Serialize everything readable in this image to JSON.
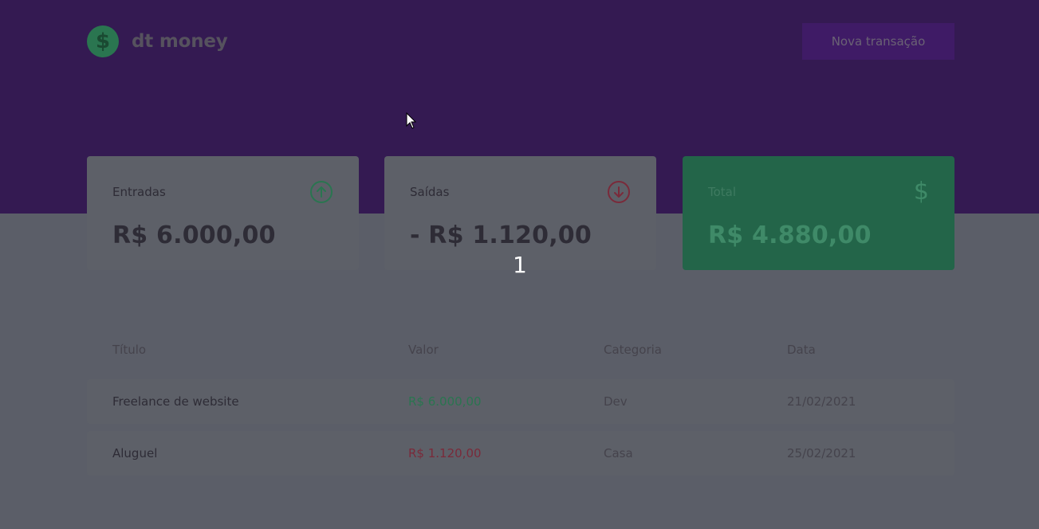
{
  "app": {
    "name": "dt money",
    "logo_symbol": "$",
    "new_transaction_label": "Nova transação"
  },
  "summary": {
    "income": {
      "label": "Entradas",
      "value": "R$ 6.000,00",
      "icon": "arrow-circle-up-icon"
    },
    "outcome": {
      "label": "Saídas",
      "value": "- R$ 1.120,00",
      "icon": "arrow-circle-down-icon"
    },
    "total": {
      "label": "Total",
      "value": "R$ 4.880,00",
      "icon": "dollar-icon",
      "symbol": "$"
    }
  },
  "overlay": {
    "step_number": "1"
  },
  "table": {
    "headers": [
      "Título",
      "Valor",
      "Categoria",
      "Data"
    ],
    "rows": [
      {
        "title": "Freelance de website",
        "amount": "R$ 6.000,00",
        "type": "deposit",
        "category": "Dev",
        "date": "21/02/2021"
      },
      {
        "title": "Aluguel",
        "amount": "R$ 1.120,00",
        "type": "withdraw",
        "category": "Casa",
        "date": "25/02/2021"
      }
    ]
  },
  "colors": {
    "header_bg": "#341a52",
    "page_bg": "#5b5e68",
    "green": "#2a7550",
    "red": "#7a2a3a"
  }
}
